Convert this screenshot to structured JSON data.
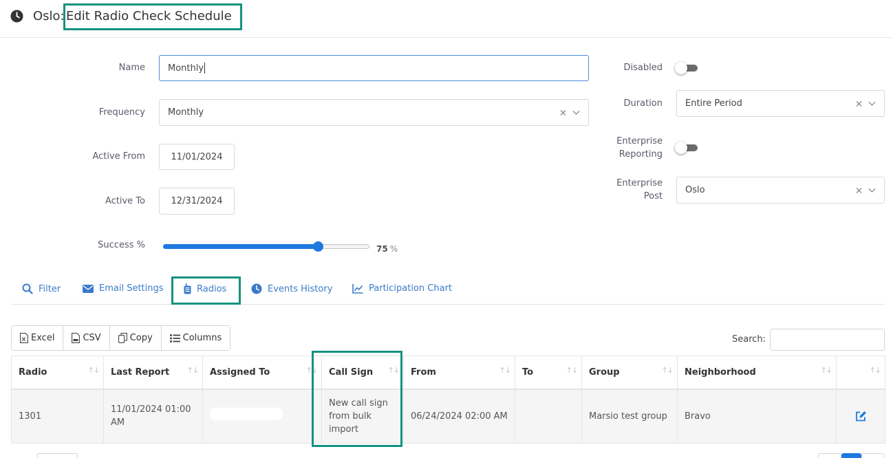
{
  "header": {
    "title_prefix": "Oslo:",
    "title": "Edit Radio Check Schedule"
  },
  "form": {
    "name": {
      "label": "Name",
      "value": "Monthly"
    },
    "frequency": {
      "label": "Frequency",
      "value": "Monthly"
    },
    "active_from": {
      "label": "Active From",
      "value": "11/01/2024"
    },
    "active_to": {
      "label": "Active To",
      "value": "12/31/2024"
    },
    "success": {
      "label": "Success %",
      "value": 75,
      "display_value": "75",
      "unit": "%"
    },
    "disabled": {
      "label": "Disabled",
      "on": false
    },
    "duration": {
      "label": "Duration",
      "value": "Entire Period"
    },
    "enterprise_reporting": {
      "label_line1": "Enterprise",
      "label_line2": "Reporting",
      "on": false
    },
    "enterprise_post": {
      "label_line1": "Enterprise",
      "label_line2": "Post",
      "value": "Oslo"
    }
  },
  "tabs": [
    {
      "label": "Filter",
      "icon": "search-icon"
    },
    {
      "label": "Email Settings",
      "icon": "envelope-icon"
    },
    {
      "label": "Radios",
      "icon": "radio-icon",
      "active": true
    },
    {
      "label": "Events History",
      "icon": "clock-icon"
    },
    {
      "label": "Participation Chart",
      "icon": "line-chart-icon"
    }
  ],
  "toolbar": {
    "excel": "Excel",
    "csv": "CSV",
    "copy": "Copy",
    "columns": "Columns",
    "search_label": "Search:"
  },
  "table": {
    "columns": [
      "Radio",
      "Last Report",
      "Assigned To",
      "Call Sign",
      "From",
      "To",
      "Group",
      "Neighborhood",
      ""
    ],
    "rows": [
      {
        "radio": "1301",
        "last_report": "11/01/2024 01:00 AM",
        "assigned_to": "",
        "call_sign": "New call sign from bulk import",
        "from": "06/24/2024 02:00 AM",
        "to": "",
        "group": "Marsio test group",
        "neighborhood": "Bravo"
      }
    ]
  },
  "colors": {
    "accent": "#1f7ae0",
    "link": "#3a7bc8",
    "highlight": "#14927f",
    "toggle_off": "#6b6b6b"
  }
}
